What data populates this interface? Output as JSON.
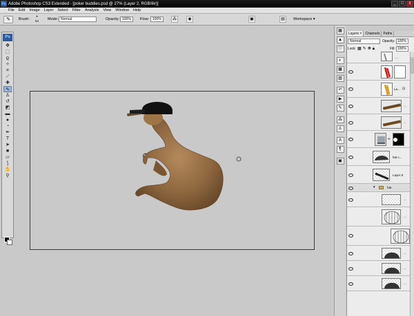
{
  "window": {
    "app_icon": "Ps",
    "title": "Adobe Photoshop CS3 Extended - [poker buddies.psd @ 27% (Layer 2, RGB/8#)]",
    "controls": [
      "_",
      "□",
      "x"
    ]
  },
  "menu": [
    "File",
    "Edit",
    "Image",
    "Layer",
    "Select",
    "Filter",
    "Analysis",
    "View",
    "Window",
    "Help"
  ],
  "options_bar": {
    "tool_icon": "brush-icon",
    "brush_label": "Brush:",
    "brush_size": "64",
    "mode_label": "Mode:",
    "mode_value": "Normal",
    "opacity_label": "Opacity:",
    "opacity_value": "100%",
    "flow_label": "Flow:",
    "flow_value": "100%",
    "workspace_label": "Workspace ▾"
  },
  "toolbox": {
    "logo": "Ps",
    "tools": [
      "move",
      "marquee",
      "lasso",
      "magic-wand",
      "crop",
      "slice",
      "healing",
      "brush",
      "stamp",
      "history-brush",
      "eraser",
      "gradient",
      "blur",
      "dodge",
      "pen",
      "type",
      "path-select",
      "shape",
      "notes",
      "eyedropper",
      "hand",
      "zoom",
      "quick-mask",
      "screen-mode"
    ],
    "active_index": 7
  },
  "layers_panel": {
    "tabs": [
      "Layers ×",
      "Channels",
      "Paths"
    ],
    "blend_mode": "Normal",
    "opacity_label": "Opacity:",
    "opacity_value": "100%",
    "lock_label": "Lock:",
    "fill_label": "Fill:",
    "fill_value": "100%",
    "layers": [
      {
        "name": "...",
        "thumb": "paint"
      },
      {
        "name": "",
        "thumb": "red-strokes",
        "mask": "white"
      },
      {
        "name": "La...",
        "thumb": "orange-strokes",
        "locked": true
      },
      {
        "name": "...",
        "thumb": "cigar"
      },
      {
        "name": "...",
        "thumb": "cigar"
      },
      {
        "name": "",
        "thumb": "levels",
        "mask": "black"
      },
      {
        "name": "hat c...",
        "thumb": "hat"
      },
      {
        "name": "Layer 8",
        "thumb": "brush-stroke"
      },
      {
        "name": "hat",
        "thumb": "folder"
      },
      {
        "name": "...",
        "thumb": "hat-pattern"
      },
      {
        "name": "...",
        "thumb": "stripes"
      },
      {
        "name": "...",
        "thumb": "stripes"
      },
      {
        "name": "...",
        "thumb": "hat-dark"
      },
      {
        "name": "...",
        "thumb": "hat-dark"
      },
      {
        "name": "...",
        "thumb": "hat-dark"
      }
    ]
  }
}
